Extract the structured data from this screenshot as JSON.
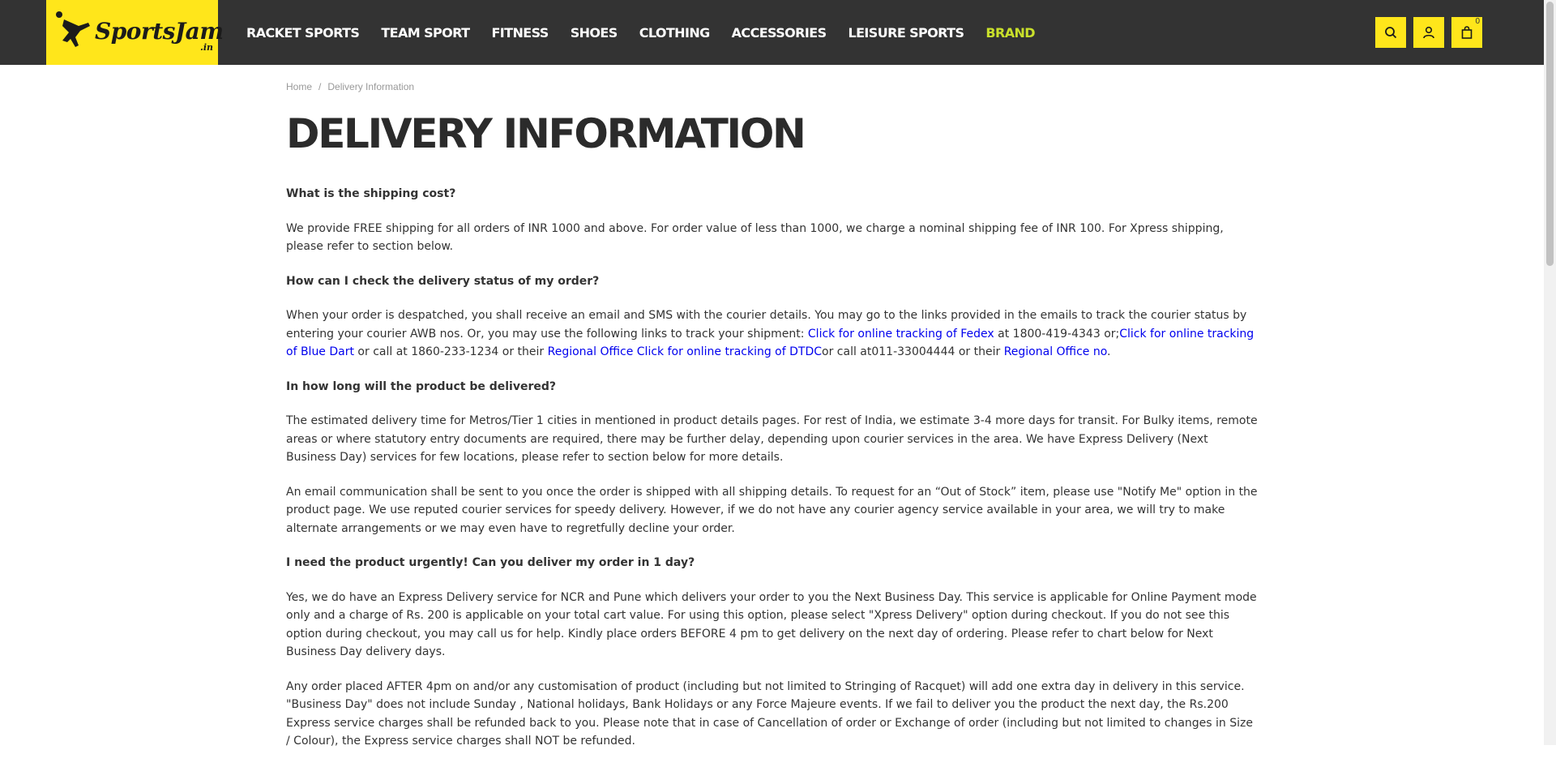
{
  "logo": {
    "text": "SportsJam",
    "tld": ".in"
  },
  "nav": [
    "RACKET SPORTS",
    "TEAM SPORT",
    "FITNESS",
    "SHOES",
    "CLOTHING",
    "ACCESSORIES",
    "LEISURE SPORTS",
    "BRAND"
  ],
  "header_icons": {
    "search": "search-icon",
    "account": "user-icon",
    "cart": "shopping-bag-icon",
    "cart_count": "0"
  },
  "breadcrumb": {
    "home": "Home",
    "separator": "/",
    "current": "Delivery Information"
  },
  "title": "DELIVERY INFORMATION",
  "colors": {
    "header_bg": "#333333",
    "accent_yellow": "#ffe61b",
    "brand_link": "#c9e02b",
    "link": "#0000ee"
  },
  "content": {
    "q1": "What is the shipping cost?",
    "a1": "We provide FREE shipping for all orders of INR 1000 and above. For order value of less than 1000, we charge a nominal shipping fee of INR 100. For Xpress shipping, please refer to section below.",
    "q2": "How can I check the delivery status of my order?",
    "a2": {
      "t1": "When your order is despatched, you shall receive an email and SMS with the courier details. You may go to the links provided in the emails to track the courier status by entering your courier AWB nos. Or, you may use the following links to track your shipment: ",
      "l1": "Click for online tracking of Fedex",
      "t2": " at 1800-419-4343 or;",
      "l2": "Click for online tracking of Blue Dart",
      "t3": " or call at 1860-233-1234 or their ",
      "l3": "Regional Office",
      "t4": " ",
      "l4": "Click for online tracking of DTDC",
      "t5": "or call at011-33004444 or their ",
      "l5": "Regional Office no",
      "t6": "."
    },
    "q3": "In how long will the product be delivered?",
    "a3": "The estimated delivery time for Metros/Tier 1 cities in mentioned in product details pages. For rest of India, we estimate 3-4 more days for transit. For Bulky items, remote areas or where statutory entry documents are required, there may be further delay, depending upon courier services in the area. We have Express Delivery (Next Business Day) services for few locations, please refer to section below for more details.",
    "a3b": "An email communication shall be sent to you once the order is shipped with all shipping details. To request for an “Out of Stock” item, please use \"Notify Me\" option in the product page. We use reputed courier services for speedy delivery. However, if we do not have any courier agency service available in your area, we will try to make alternate arrangements or we may even have to regretfully decline your order.",
    "q4": "I need the product urgently! Can you deliver my order in 1 day?",
    "a4": "Yes, we do have an Express Delivery service for NCR and Pune which delivers your order to you the Next Business Day. This service is applicable for Online Payment mode only and a charge of Rs. 200 is applicable on your total cart value. For using this option, please select \"Xpress Delivery\" option during checkout. If you do not see this option during checkout, you may call us for help. Kindly place orders BEFORE 4 pm to get delivery on the next day of ordering. Please refer to chart below for Next Business Day delivery days.",
    "a4b": "Any order placed AFTER 4pm on and/or any customisation of product (including but not limited to Stringing of Racquet) will add one extra day in delivery in this service. \"Business Day\" does not include Sunday , National holidays, Bank Holidays or any Force Majeure events. If we fail to deliver you the product the next day, the Rs.200 Express service charges shall be refunded back to you. Please note that in case of Cancellation of order or Exchange of order (including but not limited to changes in Size / Colour), the Express service charges shall NOT be refunded."
  }
}
